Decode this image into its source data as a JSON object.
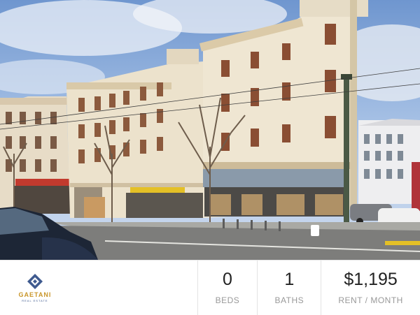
{
  "listing": {
    "photo_label": "Building exterior photo",
    "brand": {
      "name": "GAETANI",
      "sub": "REAL ESTATE",
      "color": "#c9962a",
      "mark_color": "#3f5a8f"
    },
    "stats": [
      {
        "value": "0",
        "label": "BEDS"
      },
      {
        "value": "1",
        "label": "BATHS"
      },
      {
        "value": "$1,195",
        "label": "RENT / MONTH"
      }
    ]
  }
}
